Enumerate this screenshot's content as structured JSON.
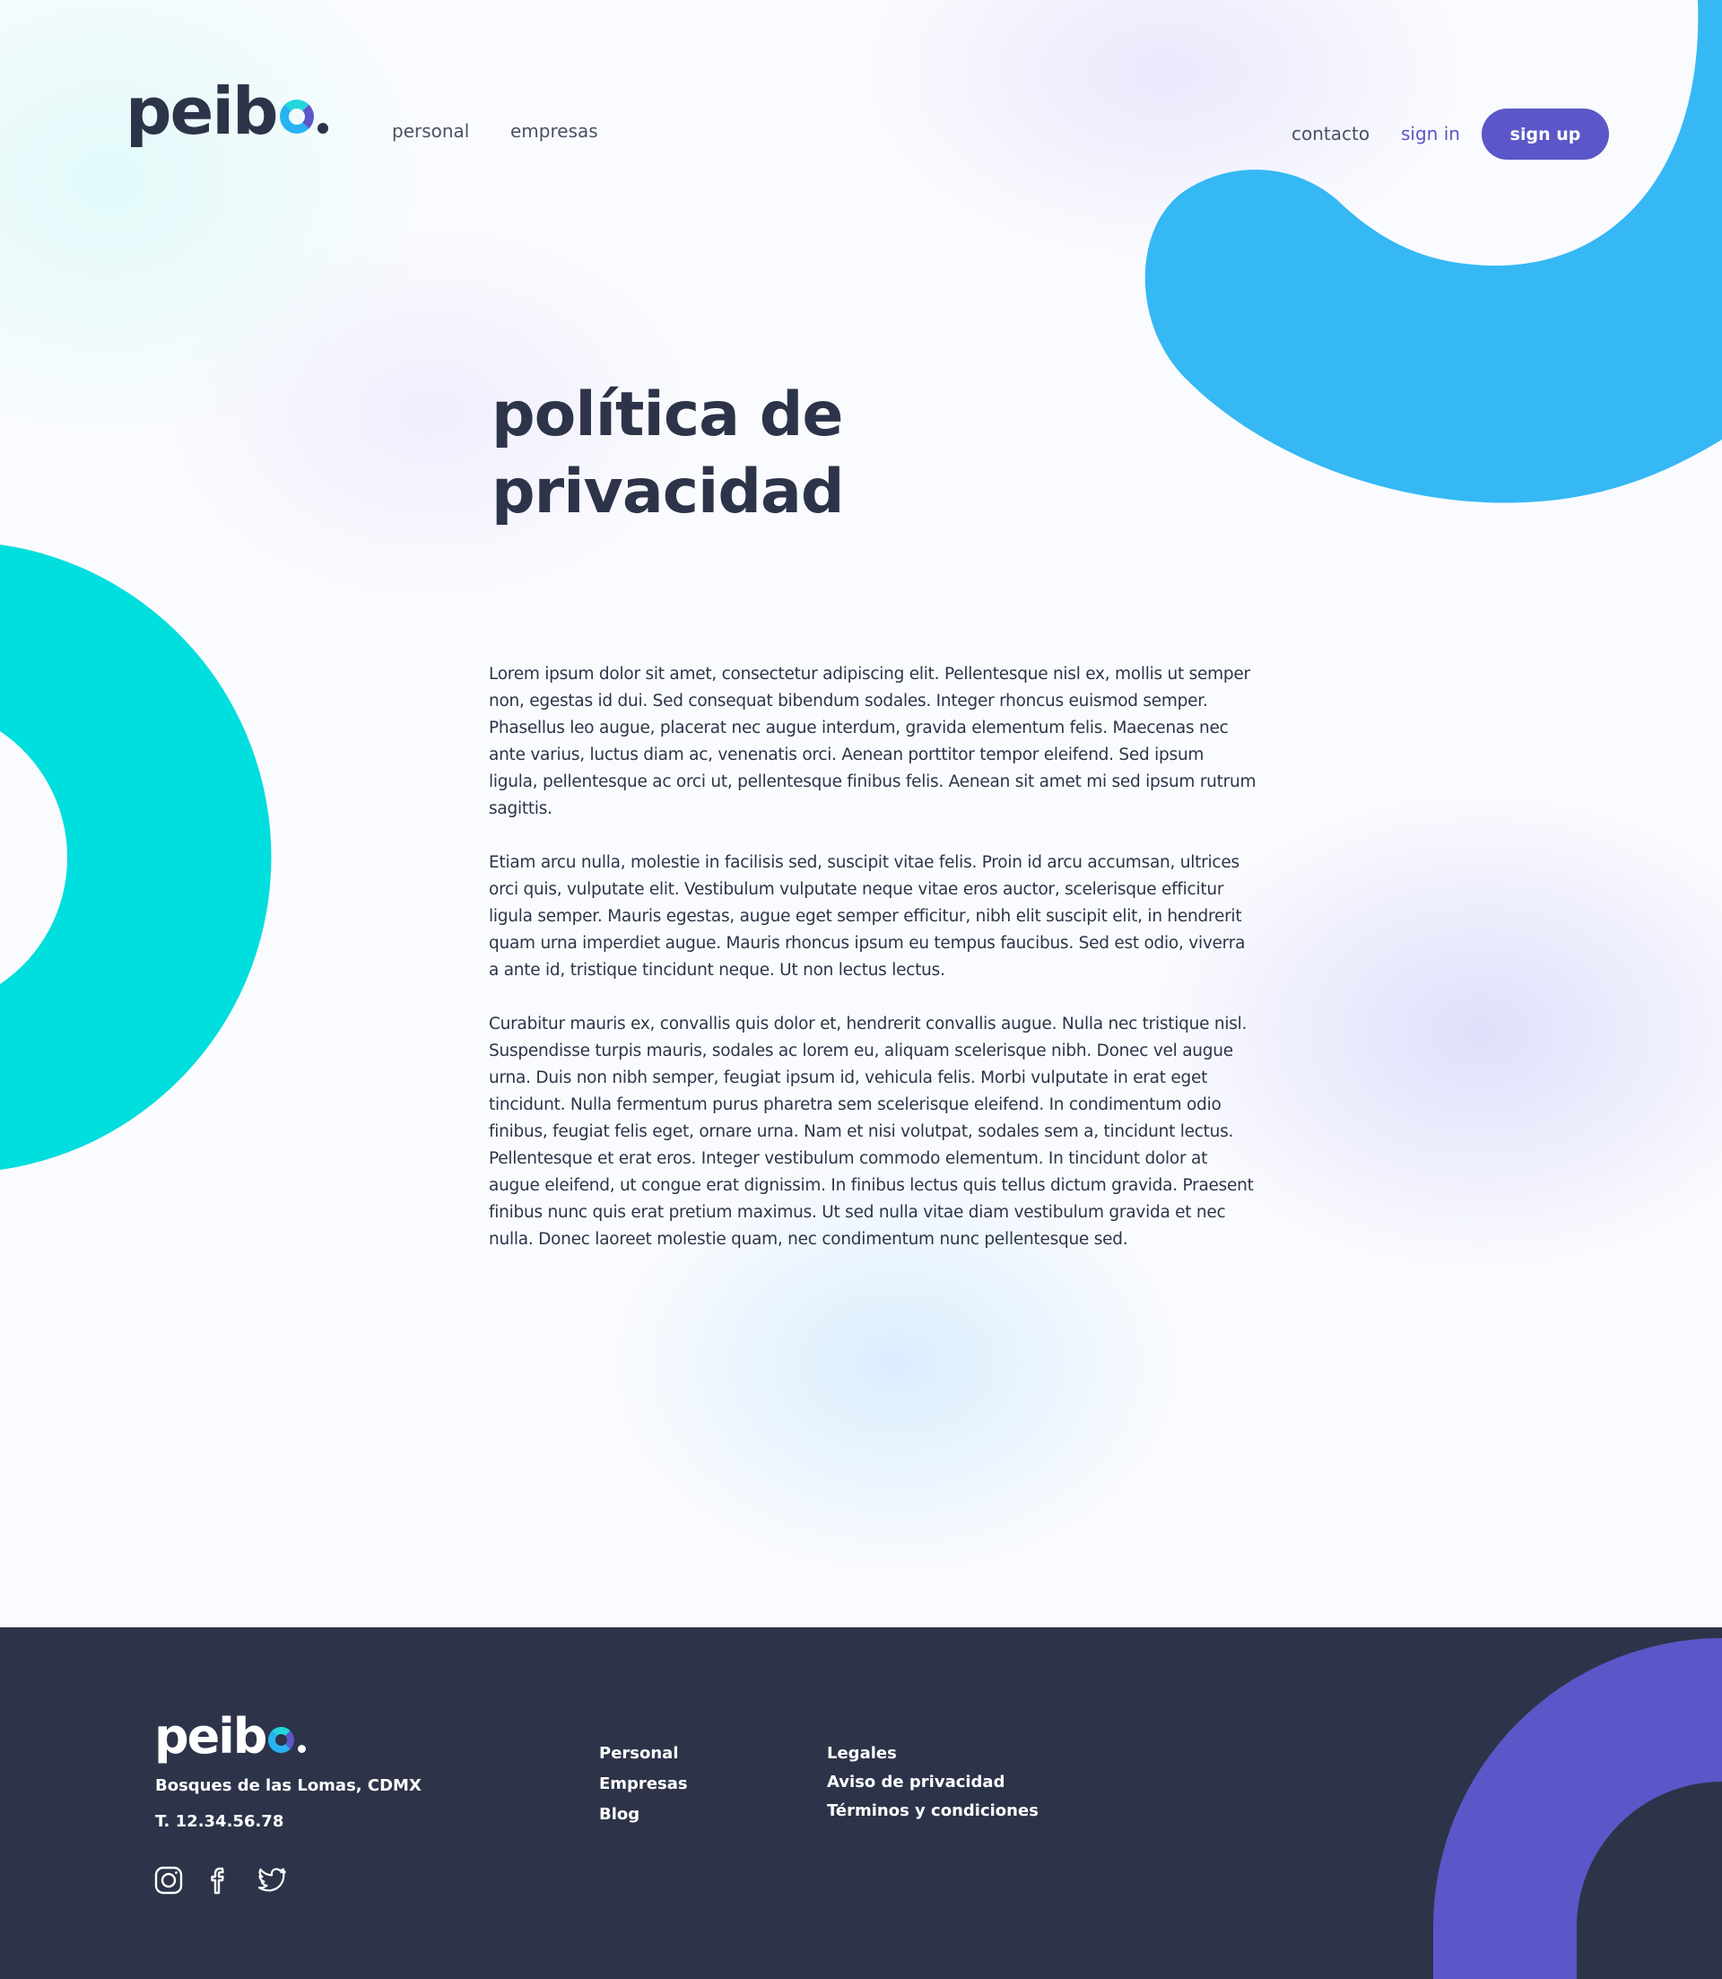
{
  "brand": {
    "logo_prefix": "peib",
    "logo_accent": "o",
    "colors": {
      "navy": "#2d3449",
      "purple": "#5b57c8",
      "blue": "#35b8f4",
      "teal": "#00dedd"
    }
  },
  "header": {
    "nav_left": [
      "personal",
      "empresas"
    ],
    "contacto": "contacto",
    "sign_in": "sign in",
    "sign_up": "sign up"
  },
  "main": {
    "title_line1": "política de",
    "title_line2": "privacidad",
    "paragraphs": [
      "Lorem ipsum dolor sit amet, consectetur adipiscing elit. Pellentesque nisl ex, mollis ut semper non, egestas id dui. Sed consequat bibendum sodales. Integer rhoncus euismod semper. Phasellus leo augue, placerat nec augue interdum, gravida elementum felis. Maecenas nec ante varius, luctus diam ac, venenatis orci. Aenean porttitor tempor eleifend. Sed ipsum ligula, pellentesque ac orci ut, pellentesque finibus felis. Aenean sit amet mi sed ipsum rutrum sagittis.",
      "Etiam arcu nulla, molestie in facilisis sed, suscipit vitae felis. Proin id arcu accumsan, ultrices orci quis, vulputate elit. Vestibulum vulputate neque vitae eros auctor, scelerisque efficitur ligula semper. Mauris egestas, augue eget semper efficitur, nibh elit suscipit elit, in hendrerit quam urna imperdiet augue. Mauris rhoncus ipsum eu tempus faucibus. Sed est odio, viverra a ante id, tristique tincidunt neque. Ut non lectus lectus.",
      "Curabitur mauris ex, convallis quis dolor et, hendrerit convallis augue. Nulla nec tristique nisl. Suspendisse turpis mauris, sodales ac lorem eu, aliquam scelerisque nibh. Donec vel augue urna. Duis non nibh semper, feugiat ipsum id, vehicula felis. Morbi vulputate in erat eget tincidunt. Nulla fermentum purus pharetra sem scelerisque eleifend. In condimentum odio finibus, feugiat felis eget, ornare urna. Nam et nisi volutpat, sodales sem a, tincidunt lectus. Pellentesque et erat eros. Integer vestibulum commodo elementum. In tincidunt dolor at augue eleifend, ut congue erat dignissim. In finibus lectus quis tellus dictum gravida. Praesent finibus nunc quis erat pretium maximus. Ut sed nulla vitae diam vestibulum gravida et nec nulla. Donec laoreet molestie quam, nec condimentum nunc pellentesque sed."
    ]
  },
  "footer": {
    "address": "Bosques de las Lomas, CDMX",
    "phone": "T. 12.34.56.78",
    "col1": [
      "Personal",
      "Empresas",
      "Blog"
    ],
    "col2": [
      "Legales",
      "Aviso de privacidad",
      "Términos y condiciones"
    ],
    "social": [
      "instagram-icon",
      "facebook-icon",
      "twitter-icon"
    ]
  }
}
